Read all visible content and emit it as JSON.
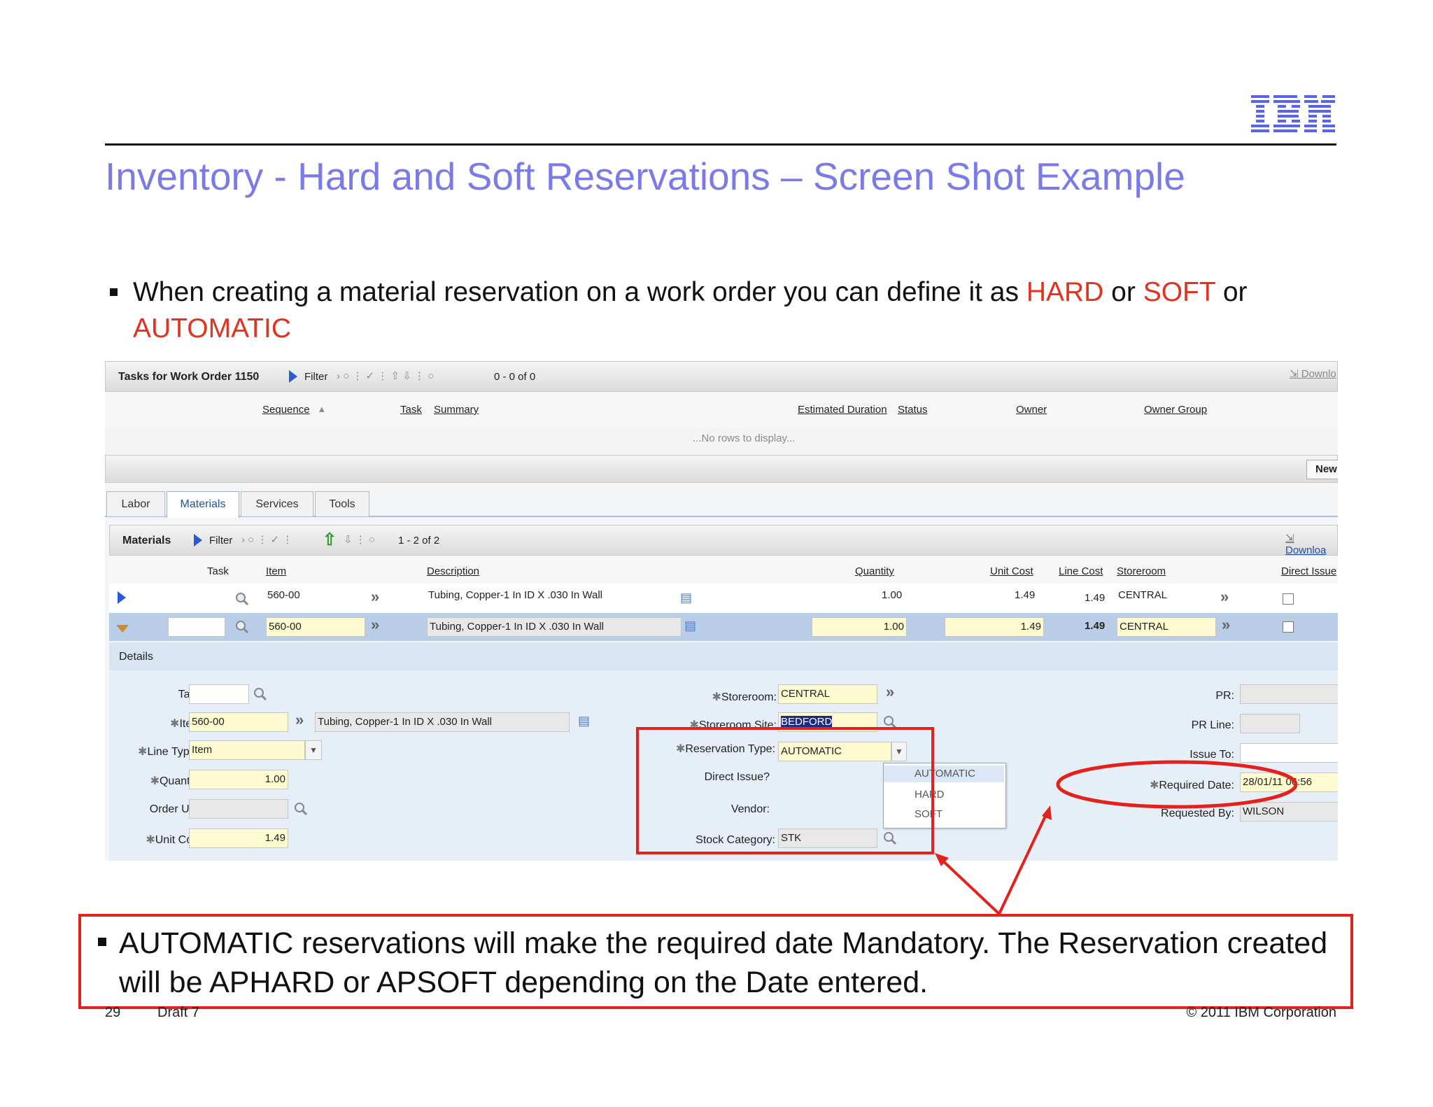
{
  "slide": {
    "title": "Inventory - Hard and Soft Reservations – Screen Shot Example",
    "bullet1": {
      "t1": "When creating a material reservation on a work order you can define it as ",
      "hard": "HARD",
      "t2": " or ",
      "soft": "SOFT",
      "t3": " or ",
      "auto": "AUTOMATIC"
    },
    "callout": "AUTOMATIC reservations will make the required date Mandatory.  The Reservation created will be APHARD or APSOFT depending on the Date entered.",
    "footer": {
      "page": "29",
      "draft": "Draft 7",
      "copyright": "© 2011 IBM Corporation"
    },
    "colors": {
      "title": "#7b7be8",
      "accent_red": "#e4321e",
      "ibm_blue": "#5a64e6"
    },
    "logo": {
      "text": "IBM"
    }
  },
  "tasks": {
    "title": "Tasks for Work Order 1150",
    "filter": "Filter",
    "count": "0 - 0 of 0",
    "download": "Downlo",
    "columns": [
      "Sequence",
      "Task",
      "Summary",
      "Estimated Duration",
      "Status",
      "Owner",
      "Owner Group"
    ],
    "empty": "...No rows to display...",
    "new_button": "New"
  },
  "tabs": [
    "Labor",
    "Materials",
    "Services",
    "Tools"
  ],
  "materials": {
    "title": "Materials",
    "filter": "Filter",
    "count": "1 - 2 of 2",
    "download": "Downloa",
    "columns": [
      "Task",
      "Item",
      "Description",
      "Quantity",
      "Unit Cost",
      "Line Cost",
      "Storeroom",
      "Direct Issue"
    ],
    "rows": [
      {
        "task": "",
        "item": "560-00",
        "description": "Tubing, Copper-1 In ID X .030 In Wall",
        "quantity": "1.00",
        "unit_cost": "1.49",
        "line_cost": "1.49",
        "storeroom": "CENTRAL"
      },
      {
        "task": "",
        "item": "560-00",
        "description": "Tubing, Copper-1 In ID X .030 In Wall",
        "quantity": "1.00",
        "unit_cost": "1.49",
        "line_cost": "1.49",
        "storeroom": "CENTRAL"
      }
    ]
  },
  "details": {
    "title": "Details",
    "task_label": "Task:",
    "task_value": "",
    "item_label": "Item:",
    "item_value": "560-00",
    "item_desc": "Tubing, Copper-1 In ID X .030 In Wall",
    "line_type_label": "Line Type:",
    "line_type_value": "Item",
    "quantity_label": "Quantity:",
    "quantity_value": "1.00",
    "order_unit_label": "Order Unit:",
    "order_unit_value": "",
    "unit_cost_label": "Unit Cost:",
    "unit_cost_value": "1.49",
    "storeroom_label": "Storeroom:",
    "storeroom_value": "CENTRAL",
    "storeroom_site_label": "Storeroom Site:",
    "storeroom_site_value": "BEDFORD",
    "reservation_type_label": "Reservation Type:",
    "reservation_type_value": "AUTOMATIC",
    "reservation_options": [
      "AUTOMATIC",
      "HARD",
      "SOFT"
    ],
    "direct_issue_label": "Direct Issue?",
    "vendor_label": "Vendor:",
    "stock_category_label": "Stock Category:",
    "stock_category_value": "STK",
    "pr_label": "PR:",
    "pr_value": "",
    "pr_line_label": "PR Line:",
    "pr_line_value": "",
    "issue_to_label": "Issue To:",
    "issue_to_value": "",
    "required_date_label": "Required Date:",
    "required_date_value": "28/01/11 06:56",
    "requested_by_label": "Requested By:",
    "requested_by_value": "WILSON"
  }
}
